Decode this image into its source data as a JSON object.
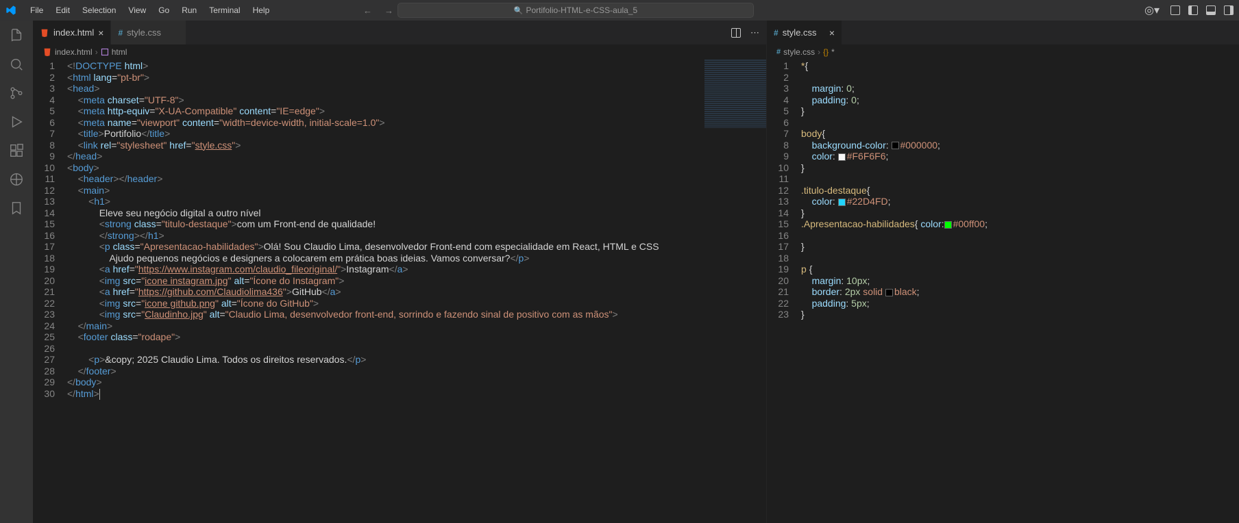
{
  "menu": [
    "File",
    "Edit",
    "Selection",
    "View",
    "Go",
    "Run",
    "Terminal",
    "Help"
  ],
  "search_text": "Portifolio-HTML-e-CSS-aula_5",
  "left_editor": {
    "tabs": [
      {
        "icon": "html",
        "label": "index.html",
        "active": true
      },
      {
        "icon": "css",
        "label": "style.css",
        "active": false
      }
    ],
    "breadcrumb": {
      "file": "index.html",
      "path": "html"
    },
    "lines": [
      {
        "n": 1,
        "html": "<span class='tag-bracket'>&lt;!</span><span class='doctype'>DOCTYPE</span> <span class='attr-name'>html</span><span class='tag-bracket'>&gt;</span>"
      },
      {
        "n": 2,
        "html": "<span class='tag-bracket'>&lt;</span><span class='tag-name'>html</span> <span class='attr-name'>lang</span>=<span class='attr-val'>\"pt-br\"</span><span class='tag-bracket'>&gt;</span>"
      },
      {
        "n": 3,
        "html": "<span class='tag-bracket'>&lt;</span><span class='tag-name'>head</span><span class='tag-bracket'>&gt;</span>"
      },
      {
        "n": 4,
        "html": "    <span class='tag-bracket'>&lt;</span><span class='tag-name'>meta</span> <span class='attr-name'>charset</span>=<span class='attr-val'>\"UTF-8\"</span><span class='tag-bracket'>&gt;</span>"
      },
      {
        "n": 5,
        "html": "    <span class='tag-bracket'>&lt;</span><span class='tag-name'>meta</span> <span class='attr-name'>http-equiv</span>=<span class='attr-val'>\"X-UA-Compatible\"</span> <span class='attr-name'>content</span>=<span class='attr-val'>\"IE=edge\"</span><span class='tag-bracket'>&gt;</span>"
      },
      {
        "n": 6,
        "html": "    <span class='tag-bracket'>&lt;</span><span class='tag-name'>meta</span> <span class='attr-name'>name</span>=<span class='attr-val'>\"viewport\"</span> <span class='attr-name'>content</span>=<span class='attr-val'>\"width=device-width, initial-scale=1.0\"</span><span class='tag-bracket'>&gt;</span>"
      },
      {
        "n": 7,
        "html": "    <span class='tag-bracket'>&lt;</span><span class='tag-name'>title</span><span class='tag-bracket'>&gt;</span><span class='text'>Portifolio</span><span class='tag-bracket'>&lt;/</span><span class='tag-name'>title</span><span class='tag-bracket'>&gt;</span>"
      },
      {
        "n": 8,
        "html": "    <span class='tag-bracket'>&lt;</span><span class='tag-name'>link</span> <span class='attr-name'>rel</span>=<span class='attr-val'>\"stylesheet\"</span> <span class='attr-name'>href</span>=<span class='attr-val'>\"<span class='underline'>style.css</span>\"</span><span class='tag-bracket'>&gt;</span>"
      },
      {
        "n": 9,
        "html": "<span class='tag-bracket'>&lt;/</span><span class='tag-name'>head</span><span class='tag-bracket'>&gt;</span>"
      },
      {
        "n": 10,
        "html": "<span class='tag-bracket'>&lt;</span><span class='tag-name'>body</span><span class='tag-bracket'>&gt;</span>"
      },
      {
        "n": 11,
        "html": "    <span class='tag-bracket'>&lt;</span><span class='tag-name'>header</span><span class='tag-bracket'>&gt;&lt;/</span><span class='tag-name'>header</span><span class='tag-bracket'>&gt;</span>"
      },
      {
        "n": 12,
        "html": "    <span class='tag-bracket'>&lt;</span><span class='tag-name'>main</span><span class='tag-bracket'>&gt;</span>"
      },
      {
        "n": 13,
        "html": "        <span class='tag-bracket'>&lt;</span><span class='tag-name'>h1</span><span class='tag-bracket'>&gt;</span>"
      },
      {
        "n": 14,
        "html": "            <span class='text'>Eleve seu negócio digital a outro nível</span>"
      },
      {
        "n": 15,
        "html": "            <span class='tag-bracket'>&lt;</span><span class='tag-name'>strong</span> <span class='attr-name'>class</span>=<span class='attr-val'>\"titulo-destaque\"</span><span class='tag-bracket'>&gt;</span><span class='text'>com um Front-end de qualidade!</span>"
      },
      {
        "n": 16,
        "html": "            <span class='tag-bracket'>&lt;/</span><span class='tag-name'>strong</span><span class='tag-bracket'>&gt;&lt;/</span><span class='tag-name'>h1</span><span class='tag-bracket'>&gt;</span>"
      },
      {
        "n": 17,
        "html": "            <span class='tag-bracket'>&lt;</span><span class='tag-name'>p</span> <span class='attr-name'>class</span>=<span class='attr-val'>\"Apresentacao-habilidades\"</span><span class='tag-bracket'>&gt;</span><span class='text'>Olá! Sou Claudio Lima, desenvolvedor Front-end com especialidade em React, HTML e CSS</span>"
      },
      {
        "n": 18,
        "html": "                <span class='text'>Ajudo pequenos negócios e designers a colocarem em prática boas ideias. Vamos conversar?</span><span class='tag-bracket'>&lt;/</span><span class='tag-name'>p</span><span class='tag-bracket'>&gt;</span>"
      },
      {
        "n": 19,
        "html": "            <span class='tag-bracket'>&lt;</span><span class='tag-name'>a</span> <span class='attr-name'>href</span>=<span class='attr-val'>\"<span class='underline'>https://www.instagram.com/claudio_fileoriginal/</span>\"</span><span class='tag-bracket'>&gt;</span><span class='text'>Instagram</span><span class='tag-bracket'>&lt;/</span><span class='tag-name'>a</span><span class='tag-bracket'>&gt;</span>"
      },
      {
        "n": 20,
        "html": "            <span class='tag-bracket'>&lt;</span><span class='tag-name'>img</span> <span class='attr-name'>src</span>=<span class='attr-val'>\"<span class='underline'>icone instagram.jpg</span>\"</span> <span class='attr-name'>alt</span>=<span class='attr-val'>\"Ícone do Instagram\"</span><span class='tag-bracket'>&gt;</span>"
      },
      {
        "n": 21,
        "html": "            <span class='tag-bracket'>&lt;</span><span class='tag-name'>a</span> <span class='attr-name'>href</span>=<span class='attr-val'>\"<span class='underline'>https://github.com/Claudiolima436</span>\"</span><span class='tag-bracket'>&gt;</span><span class='text'>GitHub</span><span class='tag-bracket'>&lt;/</span><span class='tag-name'>a</span><span class='tag-bracket'>&gt;</span>"
      },
      {
        "n": 22,
        "html": "            <span class='tag-bracket'>&lt;</span><span class='tag-name'>img</span> <span class='attr-name'>src</span>=<span class='attr-val'>\"<span class='underline'>icone github.png</span>\"</span> <span class='attr-name'>alt</span>=<span class='attr-val'>\"Ícone do GitHub\"</span><span class='tag-bracket'>&gt;</span>"
      },
      {
        "n": 23,
        "html": "            <span class='tag-bracket'>&lt;</span><span class='tag-name'>img</span> <span class='attr-name'>src</span>=<span class='attr-val'>\"<span class='underline'>Claudinho.jpg</span>\"</span> <span class='attr-name'>alt</span>=<span class='attr-val'>\"Claudio Lima, desenvolvedor front-end, sorrindo e fazendo sinal de positivo com as mãos\"</span><span class='tag-bracket'>&gt;</span>"
      },
      {
        "n": 24,
        "html": "    <span class='tag-bracket'>&lt;/</span><span class='tag-name'>main</span><span class='tag-bracket'>&gt;</span>"
      },
      {
        "n": 25,
        "html": "    <span class='tag-bracket'>&lt;</span><span class='tag-name'>footer</span> <span class='attr-name'>class</span>=<span class='attr-val'>\"rodape\"</span><span class='tag-bracket'>&gt;</span>"
      },
      {
        "n": 26,
        "html": ""
      },
      {
        "n": 27,
        "html": "        <span class='tag-bracket'>&lt;</span><span class='tag-name'>p</span><span class='tag-bracket'>&gt;</span><span class='text'>&amp;copy; 2025 Claudio Lima. Todos os direitos reservados.</span><span class='tag-bracket'>&lt;/</span><span class='tag-name'>p</span><span class='tag-bracket'>&gt;</span>"
      },
      {
        "n": 28,
        "html": "    <span class='tag-bracket'>&lt;/</span><span class='tag-name'>footer</span><span class='tag-bracket'>&gt;</span>"
      },
      {
        "n": 29,
        "html": "<span class='tag-bracket'>&lt;/</span><span class='tag-name'>body</span><span class='tag-bracket'>&gt;</span>"
      },
      {
        "n": 30,
        "html": "<span class='tag-bracket'>&lt;/</span><span class='tag-name'>html</span><span class='tag-bracket'>&gt;</span><span class='cursor-line'></span>"
      }
    ]
  },
  "right_editor": {
    "tabs": [
      {
        "icon": "css",
        "label": "style.css",
        "active": true
      }
    ],
    "breadcrumb": {
      "file": "style.css",
      "path": "*"
    },
    "lines": [
      {
        "n": 1,
        "html": "<span class='sel-yellow'>*</span><span class='css-punct'>{</span>"
      },
      {
        "n": 2,
        "html": ""
      },
      {
        "n": 3,
        "html": "    <span class='css-prop'>margin</span><span class='css-punct'>:</span> <span class='css-num'>0</span><span class='css-punct'>;</span>"
      },
      {
        "n": 4,
        "html": "    <span class='css-prop'>padding</span><span class='css-punct'>:</span> <span class='css-num'>0</span><span class='css-punct'>;</span>"
      },
      {
        "n": 5,
        "html": "<span class='css-punct'>}</span>"
      },
      {
        "n": 6,
        "html": ""
      },
      {
        "n": 7,
        "html": "<span class='sel-yellow'>body</span><span class='css-punct'>{</span>"
      },
      {
        "n": 8,
        "html": "    <span class='css-prop'>background-color</span><span class='css-punct'>:</span> <span class='swatch' style='background:#000000'></span><span class='css-val'>#000000</span><span class='css-punct'>;</span>"
      },
      {
        "n": 9,
        "html": "    <span class='css-prop'>color</span><span class='css-punct'>:</span> <span class='swatch' style='background:#F6F6F6'></span><span class='css-val'>#F6F6F6</span><span class='css-punct'>;</span>"
      },
      {
        "n": 10,
        "html": "<span class='css-punct'>}</span>"
      },
      {
        "n": 11,
        "html": ""
      },
      {
        "n": 12,
        "html": "<span class='sel-yellow'>.titulo-destaque</span><span class='css-punct'>{</span>"
      },
      {
        "n": 13,
        "html": "    <span class='css-prop'>color</span><span class='css-punct'>:</span> <span class='swatch' style='background:#22D4FD'></span><span class='css-val'>#22D4FD</span><span class='css-punct'>;</span>"
      },
      {
        "n": 14,
        "html": "<span class='css-punct'>}</span>"
      },
      {
        "n": 15,
        "html": "<span class='sel-yellow'>.Apresentacao-habilidades</span><span class='css-punct'>{</span> <span class='css-prop'>color</span><span class='css-punct'>:</span><span class='swatch' style='background:#00ff00'></span><span class='css-val'>#00ff00</span><span class='css-punct'>;</span>"
      },
      {
        "n": 16,
        "html": ""
      },
      {
        "n": 17,
        "html": "<span class='css-punct'>}</span>"
      },
      {
        "n": 18,
        "html": ""
      },
      {
        "n": 19,
        "html": "<span class='sel-yellow'>p</span> <span class='css-punct'>{</span>"
      },
      {
        "n": 20,
        "html": "    <span class='css-prop'>margin</span><span class='css-punct'>:</span> <span class='css-num'>10px</span><span class='css-punct'>;</span>"
      },
      {
        "n": 21,
        "html": "    <span class='css-prop'>border</span><span class='css-punct'>:</span> <span class='css-num'>2px</span> <span class='css-val'>solid</span> <span class='swatch' style='background:#000000'></span><span class='css-val'>black</span><span class='css-punct'>;</span>"
      },
      {
        "n": 22,
        "html": "    <span class='css-prop'>padding</span><span class='css-punct'>:</span> <span class='css-num'>5px</span><span class='css-punct'>;</span>"
      },
      {
        "n": 23,
        "html": "<span class='css-punct'>}</span>"
      }
    ]
  }
}
